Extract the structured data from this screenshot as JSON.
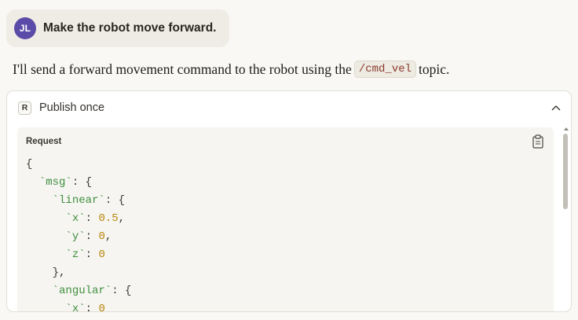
{
  "user_message": {
    "initials": "JL",
    "text": "Make the robot move forward.",
    "avatar_color": "#5b4ba8"
  },
  "assistant": {
    "text_before": "I'll send a forward movement command to the robot using the",
    "code": "/cmd_vel",
    "text_after": "topic."
  },
  "tool_call": {
    "badge": "R",
    "title": "Publish once",
    "collapse_icon": "chevron-up-icon",
    "request_label": "Request",
    "copy_icon": "clipboard-icon",
    "code_lines": {
      "l1": "{",
      "msg_key": "`msg`",
      "linear_key": "`linear`",
      "x_key": "`x`",
      "x_val": "0.5",
      "y_key": "`y`",
      "y_val": "0",
      "z_key": "`z`",
      "z_val": "0",
      "close_linear": "},",
      "angular_key": "`angular`",
      "ax_key": "`x`",
      "ax_val": "0"
    }
  }
}
